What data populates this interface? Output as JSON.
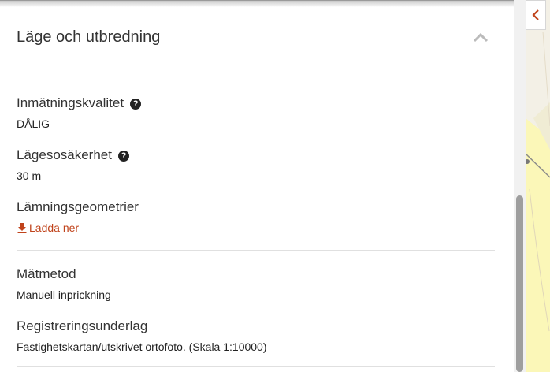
{
  "section": {
    "title": "Läge och utbredning"
  },
  "fields": {
    "quality": {
      "label": "Inmätningskvalitet",
      "value": "DÅLIG",
      "help": "?"
    },
    "uncertainty": {
      "label": "Lägesosäkerhet",
      "value": "30 m",
      "help": "?"
    },
    "geometries": {
      "label": "Lämningsgeometrier",
      "download_label": "Ladda ner"
    },
    "method": {
      "label": "Mätmetod",
      "value": "Manuell inprickning"
    },
    "basis": {
      "label": "Registreringsunderlag",
      "value": "Fastighetskartan/utskrivet ortofoto. (Skala 1:10000)"
    }
  },
  "icons": {
    "collapse": "chevron-up-icon",
    "help": "help-icon",
    "download": "download-icon",
    "panel_toggle": "chevron-left-icon"
  },
  "colors": {
    "link": "#c0431b",
    "map_yellow": "#fbf7b8",
    "map_green": "#d8ecc4"
  },
  "scroll": {
    "position": 0.92
  }
}
